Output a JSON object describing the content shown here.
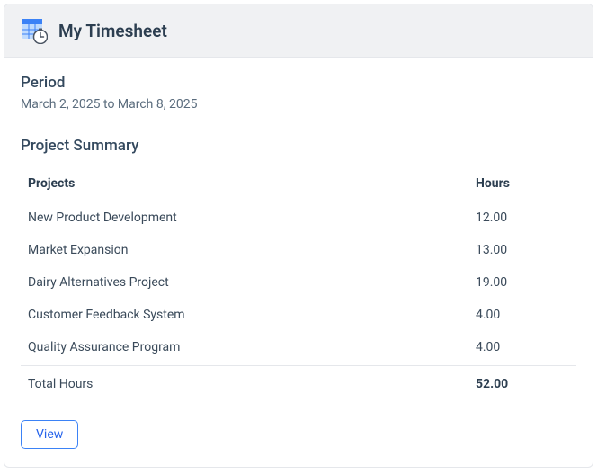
{
  "header": {
    "title": "My Timesheet"
  },
  "period": {
    "label": "Period",
    "value": "March 2, 2025 to March 8, 2025"
  },
  "summary": {
    "title": "Project Summary",
    "columns": {
      "projects": "Projects",
      "hours": "Hours"
    },
    "rows": [
      {
        "project": "New Product Development",
        "hours": "12.00"
      },
      {
        "project": "Market Expansion",
        "hours": "13.00"
      },
      {
        "project": "Dairy Alternatives Project",
        "hours": "19.00"
      },
      {
        "project": "Customer Feedback System",
        "hours": "4.00"
      },
      {
        "project": "Quality Assurance Program",
        "hours": "4.00"
      }
    ],
    "total": {
      "label": "Total Hours",
      "hours": "52.00"
    }
  },
  "actions": {
    "view": "View"
  }
}
